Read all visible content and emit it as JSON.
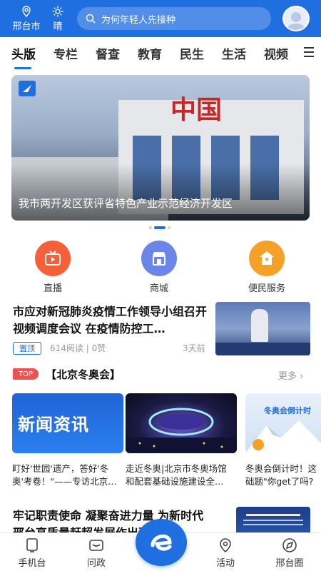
{
  "header": {
    "city": "邢台市",
    "weather": "晴",
    "search_placeholder": "为何年轻人先接种"
  },
  "nav": {
    "tabs": [
      "头版",
      "专栏",
      "督查",
      "教育",
      "民生",
      "生活",
      "视频"
    ],
    "active": "头版"
  },
  "banner": {
    "caption": "我市两开发区获评省特色产业示范经济开发区",
    "sign_text": "中国"
  },
  "services": [
    {
      "label": "直播",
      "color": "#f5603a"
    },
    {
      "label": "商城",
      "color": "#6b86e8"
    },
    {
      "label": "便民服务",
      "color": "#f4a12a"
    }
  ],
  "news1": {
    "title": "市应对新冠肺炎疫情工作领导小组召开视频调度会议 在疫情防控工…",
    "pin": "置顶",
    "stats": "614阅读 | 0赞",
    "time": "3天前"
  },
  "topic": {
    "badge": "TOP",
    "title": "【北京冬奥会】",
    "more": "更多",
    "cards": [
      {
        "text1": "盯好'世园'遗产，答好'冬",
        "text2": "奥'考卷！\"——专访北京…",
        "img_text": "新闻资讯"
      },
      {
        "text1": "走近冬奥|北京市冬奥场馆",
        "text2": "和配套基础设施建设全…",
        "img_text": ""
      },
      {
        "text1": "冬奥会倒计时！这",
        "text2": "础题\"你get了吗?",
        "img_text": "冬奥会倒计时"
      }
    ]
  },
  "news2": {
    "title": "牢记职责使命 凝聚奋进力量 为新时代邢台高质量赶超发展作出更…"
  },
  "bottom": {
    "items": [
      "手机台",
      "问政",
      "活动",
      "邢台圈"
    ]
  }
}
